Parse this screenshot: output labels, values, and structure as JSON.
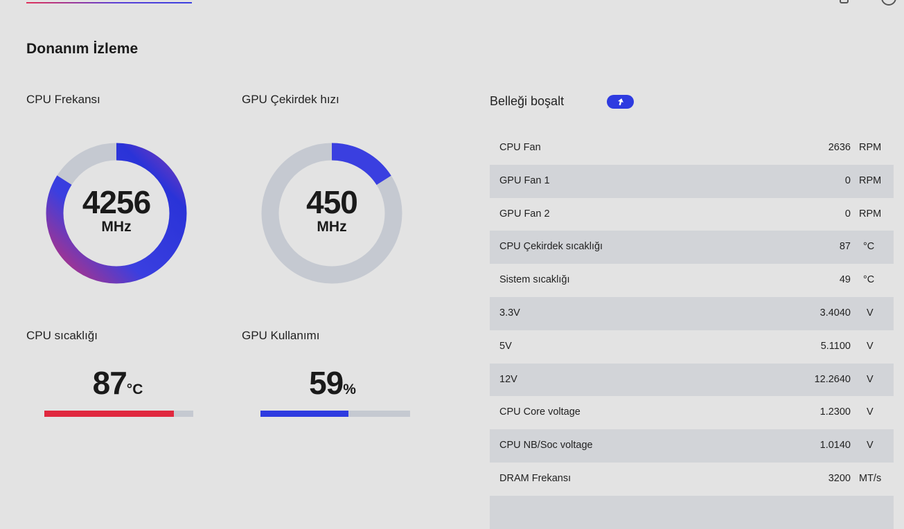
{
  "page": {
    "title": "Donanım İzleme"
  },
  "colors": {
    "accent_blue": "#2e3be0",
    "accent_magenta": "#c0317a",
    "temp_red": "#e0283f",
    "track_gray": "#c5c9d1"
  },
  "widgets": {
    "cpu_freq": {
      "label": "CPU Frekansı",
      "value": "4256",
      "unit": "MHz",
      "fill_fraction": 0.84
    },
    "gpu_clock": {
      "label": "GPU Çekirdek hızı",
      "value": "450",
      "unit": "MHz",
      "fill_fraction": 0.16
    },
    "cpu_temp": {
      "label": "CPU sıcaklığı",
      "value": "87",
      "unit": "°C",
      "fill_fraction": 0.87
    },
    "gpu_usage": {
      "label": "GPU Kullanımı",
      "value": "59",
      "unit": "%",
      "fill_fraction": 0.59
    }
  },
  "memory": {
    "label": "Belleği boşalt",
    "button_icon": "boost-arrow-icon"
  },
  "sensors": [
    {
      "name": "CPU Fan",
      "value": "2636",
      "unit": "RPM"
    },
    {
      "name": "GPU Fan 1",
      "value": "0",
      "unit": "RPM"
    },
    {
      "name": "GPU Fan 2",
      "value": "0",
      "unit": "RPM"
    },
    {
      "name": "CPU Çekirdek sıcaklığı",
      "value": "87",
      "unit": "°C"
    },
    {
      "name": "Sistem sıcaklığı",
      "value": "49",
      "unit": "°C"
    },
    {
      "name": "3.3V",
      "value": "3.4040",
      "unit": "V"
    },
    {
      "name": "5V",
      "value": "5.1100",
      "unit": "V"
    },
    {
      "name": "12V",
      "value": "12.2640",
      "unit": "V"
    },
    {
      "name": "CPU Core voltage",
      "value": "1.2300",
      "unit": "V"
    },
    {
      "name": "CPU NB/Soc voltage",
      "value": "1.0140",
      "unit": "V"
    },
    {
      "name": "DRAM Frekansı",
      "value": "3200",
      "unit": "MT/s"
    },
    {
      "name": "",
      "value": "",
      "unit": ""
    }
  ]
}
